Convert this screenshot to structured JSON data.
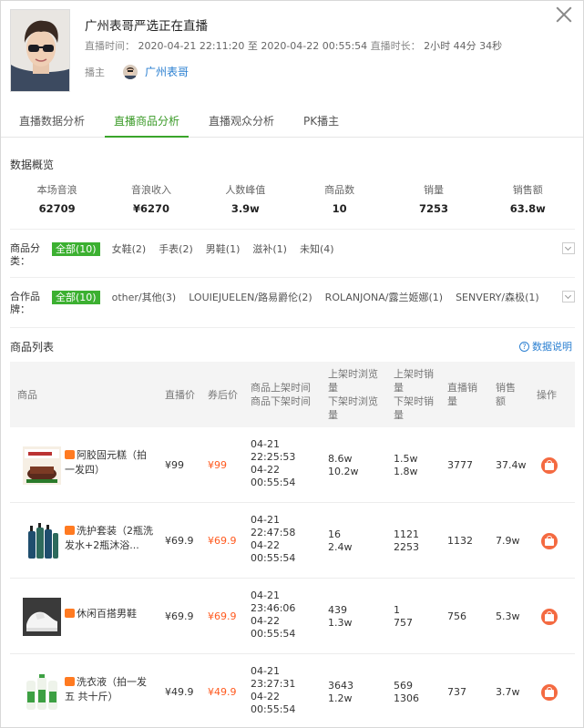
{
  "header": {
    "title": "广州表哥严选正在直播",
    "time_label": "直播时间：",
    "time_value": "2020-04-21 22:11:20 至 2020-04-22 00:55:54",
    "duration_label": "直播时长：",
    "duration_value": "2小时 44分 34秒",
    "anchor_label": "播主",
    "anchor_name": "广州表哥"
  },
  "tabs": [
    "直播数据分析",
    "直播商品分析",
    "直播观众分析",
    "PK播主"
  ],
  "overview": {
    "title": "数据概览",
    "stats": [
      {
        "label": "本场音浪",
        "value": "62709"
      },
      {
        "label": "音浪收入",
        "value": "¥6270"
      },
      {
        "label": "人数峰值",
        "value": "3.9w"
      },
      {
        "label": "商品数",
        "value": "10"
      },
      {
        "label": "销量",
        "value": "7253"
      },
      {
        "label": "销售额",
        "value": "63.8w"
      }
    ]
  },
  "category_filter": {
    "label": "商品分类：",
    "options": [
      "全部(10)",
      "女鞋(2)",
      "手表(2)",
      "男鞋(1)",
      "滋补(1)",
      "未知(4)"
    ]
  },
  "brand_filter": {
    "label": "合作品牌：",
    "options": [
      "全部(10)",
      "other/其他(3)",
      "LOUIEJUELEN/路易爵伦(2)",
      "ROLANJONA/露兰姬娜(1)",
      "SENVERY/森极(1)"
    ]
  },
  "product_list": {
    "title": "商品列表",
    "help": "数据说明",
    "headers": {
      "product": "商品",
      "live_price": "直播价",
      "coupon_price": "券后价",
      "shelf_time": "商品上架时间",
      "off_time": "商品下架时间",
      "on_views": "上架时浏览量",
      "off_views": "下架时浏览量",
      "on_sales": "上架时销量",
      "off_sales": "下架时销量",
      "live_sales": "直播销量",
      "revenue": "销售额",
      "action": "操作"
    },
    "rows": [
      {
        "name": "阿胶固元糕（拍一发四）",
        "live_price": "¥99",
        "coupon_price": "¥99",
        "on_date": "04-21",
        "on_clock": "22:25:53",
        "off_date": "04-22",
        "off_clock": "00:55:54",
        "on_views": "8.6w",
        "off_views": "10.2w",
        "on_sales": "1.5w",
        "off_sales": "1.8w",
        "live_sales": "3777",
        "revenue": "37.4w"
      },
      {
        "name": "洗护套装（2瓶洗发水+2瓶沐浴...",
        "live_price": "¥69.9",
        "coupon_price": "¥69.9",
        "on_date": "04-21",
        "on_clock": "22:47:58",
        "off_date": "04-22",
        "off_clock": "00:55:54",
        "on_views": "16",
        "off_views": "2.4w",
        "on_sales": "1121",
        "off_sales": "2253",
        "live_sales": "1132",
        "revenue": "7.9w"
      },
      {
        "name": "休闲百搭男鞋",
        "live_price": "¥69.9",
        "coupon_price": "¥69.9",
        "on_date": "04-21",
        "on_clock": "23:46:06",
        "off_date": "04-22",
        "off_clock": "00:55:54",
        "on_views": "439",
        "off_views": "1.3w",
        "on_sales": "1",
        "off_sales": "757",
        "live_sales": "756",
        "revenue": "5.3w"
      },
      {
        "name": "洗衣液（拍一发五 共十斤）",
        "live_price": "¥49.9",
        "coupon_price": "¥49.9",
        "on_date": "04-21",
        "on_clock": "23:27:31",
        "off_date": "04-22",
        "off_clock": "00:55:54",
        "on_views": "3643",
        "off_views": "1.2w",
        "on_sales": "569",
        "off_sales": "1306",
        "live_sales": "737",
        "revenue": "3.7w"
      }
    ]
  }
}
